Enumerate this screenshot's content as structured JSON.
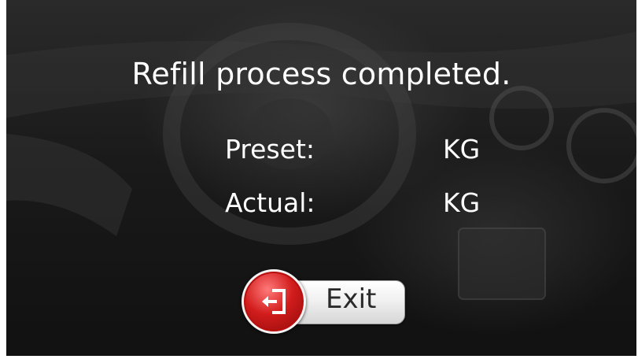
{
  "dialog": {
    "message": "Refill process completed.",
    "preset": {
      "label": "Preset:",
      "unit": "KG"
    },
    "actual": {
      "label": "Actual:",
      "unit": "KG"
    }
  },
  "exit_button": {
    "label": "Exit",
    "icon": "exit-door-icon"
  },
  "colors": {
    "text": "#ffffff",
    "exit_circle": "#d21c1c",
    "button_text": "#2a2a2a"
  }
}
